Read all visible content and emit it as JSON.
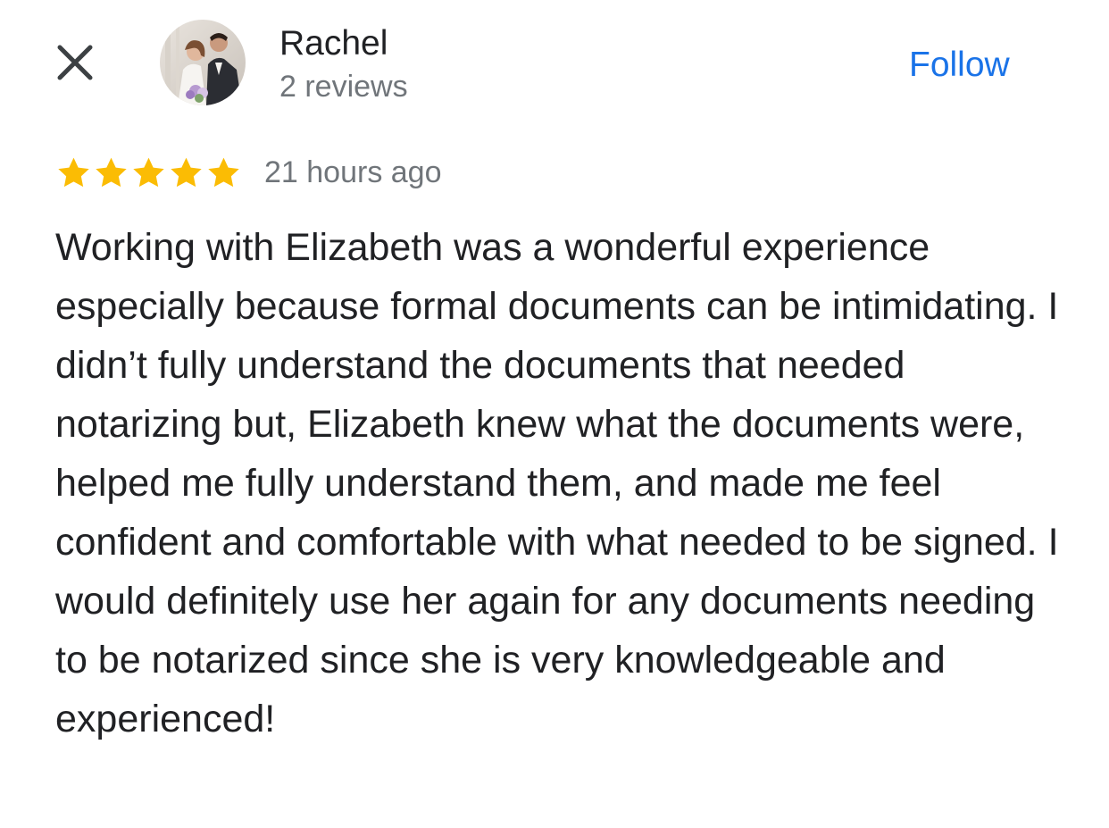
{
  "header": {
    "close_icon": "close-icon",
    "reviewer_name": "Rachel",
    "review_count": "2 reviews",
    "follow_label": "Follow"
  },
  "review": {
    "rating": 5,
    "rating_max": 5,
    "star_color": "#fbbc04",
    "timestamp": "21 hours ago",
    "text": "Working with Elizabeth was a wonderful experience especially because formal documents can be intimidating. I didn’t fully understand the documents that needed notarizing but, Elizabeth knew what the documents were, helped me fully understand them, and made me feel confident and comfortable with what needed to be signed. I would definitely use her again for any documents needing to be notarized since she is very knowledgeable and experienced!"
  },
  "colors": {
    "accent": "#1a73e8",
    "secondary_text": "#70757a",
    "primary_text": "#202124"
  }
}
